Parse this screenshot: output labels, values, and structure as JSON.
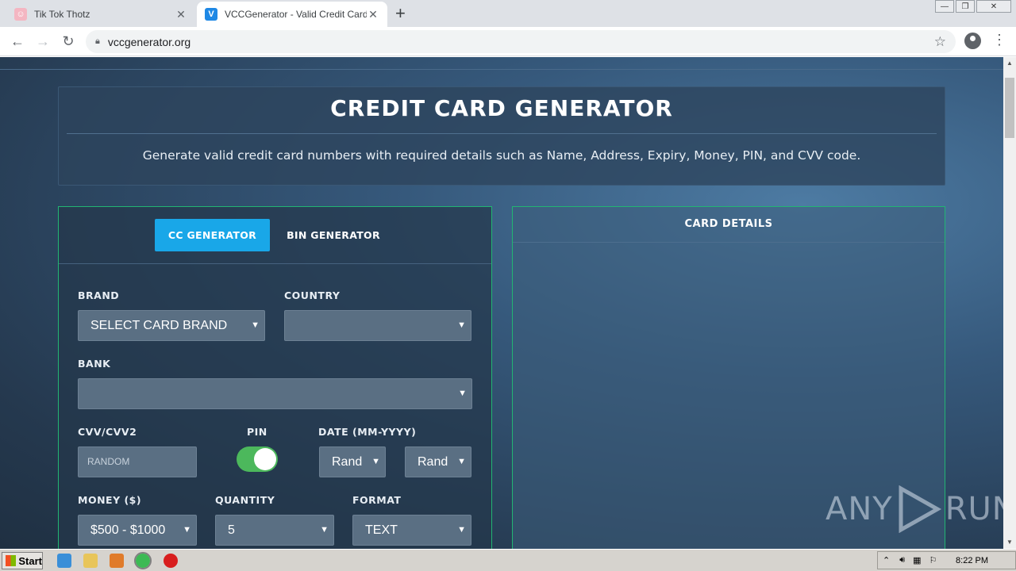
{
  "browser": {
    "tabs": [
      {
        "title": "Tik Tok Thotz",
        "close": "✕"
      },
      {
        "title": "VCCGenerator - Valid Credit Card Ge",
        "close": "✕"
      }
    ],
    "new_tab": "+",
    "url": "vccgenerator.org"
  },
  "page": {
    "title": "CREDIT CARD GENERATOR",
    "subtitle": "Generate valid credit card numbers with required details such as Name, Address, Expiry, Money, PIN, and CVV code.",
    "tabs": {
      "cc": "CC GENERATOR",
      "bin": "BIN GENERATOR"
    },
    "form": {
      "brand_label": "BRAND",
      "brand_value": "SELECT CARD BRAND",
      "country_label": "COUNTRY",
      "country_value": "",
      "bank_label": "BANK",
      "bank_value": "",
      "cvv_label": "CVV/CVV2",
      "cvv_placeholder": "RANDOM",
      "pin_label": "PIN",
      "pin_on": true,
      "date_label": "DATE (MM-YYYY)",
      "month_value": "Rand",
      "year_value": "Rand",
      "money_label": "MONEY ($)",
      "money_value": "$500 - $1000",
      "quantity_label": "QUANTITY",
      "quantity_value": "5",
      "format_label": "FORMAT",
      "format_value": "TEXT"
    },
    "card_details": {
      "title": "CARD DETAILS"
    },
    "watermark": {
      "left": "ANY",
      "right": "RUN"
    }
  },
  "taskbar": {
    "start": "Start",
    "clock": "8:22 PM"
  },
  "colors": {
    "accent": "#19a7e8",
    "panel_border": "#22b573",
    "toggle_on": "#4cb85c"
  }
}
